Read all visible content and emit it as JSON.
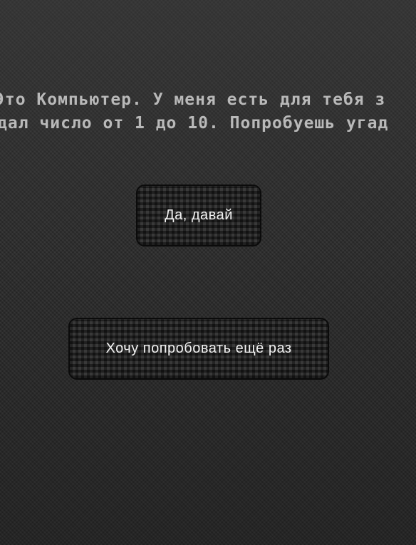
{
  "message": {
    "line1": "Это Компьютер. У меня есть для тебя з",
    "line2": "дал число от 1 до 10. Попробуешь угад"
  },
  "buttons": {
    "yes_label": "Да, давай",
    "retry_label": "Хочу попробовать ещё раз"
  },
  "colors": {
    "background": "#2a2a2a",
    "message_text": "#b9b9b9",
    "button_text": "#f2f2f2",
    "button_border": "#0b0b0b"
  }
}
